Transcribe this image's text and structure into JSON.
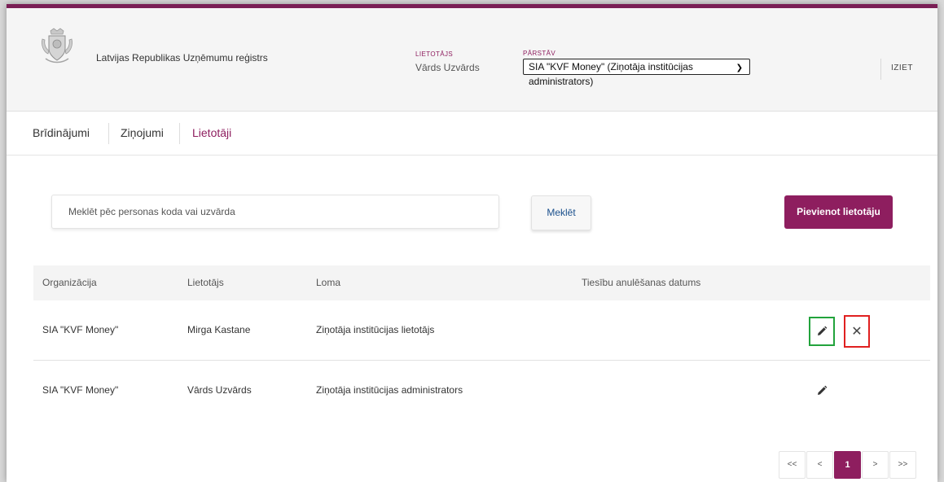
{
  "header": {
    "org_name": "Latvijas Republikas Uzņēmumu reģistrs",
    "user_label": "LIETOTĀJS",
    "user_name": "Vārds Uzvārds",
    "represents_label": "PĀRSTĀV",
    "represents_value": "SIA \"KVF Money\" (Ziņotāja institūcijas administrators)",
    "logout": "IZIET"
  },
  "nav": {
    "tabs": [
      {
        "label": "Brīdinājumi"
      },
      {
        "label": "Ziņojumi"
      },
      {
        "label": "Lietotāji"
      }
    ]
  },
  "search": {
    "placeholder": "Meklēt pēc personas koda vai uzvārda",
    "button": "Meklēt"
  },
  "add_user_button": "Pievienot lietotāju",
  "table": {
    "columns": [
      "Organizācija",
      "Lietotājs",
      "Loma",
      "Tiesību anulēšanas datums"
    ],
    "rows": [
      {
        "organization": "SIA \"KVF Money\"",
        "user": "Mirga Kastane",
        "role": "Ziņotāja institūcijas lietotājs",
        "revocation_date": ""
      },
      {
        "organization": "SIA \"KVF Money\"",
        "user": "Vārds Uzvārds",
        "role": "Ziņotāja institūcijas administrators",
        "revocation_date": ""
      }
    ]
  },
  "pagination": {
    "first": "<<",
    "prev": "<",
    "current": "1",
    "next": ">",
    "last": ">>"
  },
  "colors": {
    "brand": "#8e1e5f",
    "highlight_edit": "#22a33c",
    "highlight_delete": "#e02020"
  }
}
